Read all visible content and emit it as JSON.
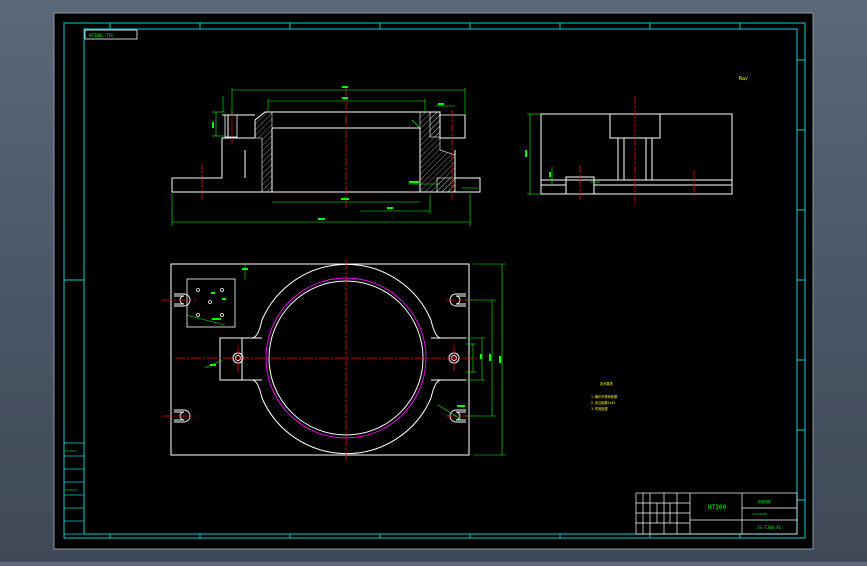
{
  "drawing": {
    "sheet_title_tag": "HT300L-TTX",
    "roughness_mark": "Ra√",
    "material": "HT300",
    "notes": [
      "技术要求",
      "1.铸件不得有砂眼",
      "2.未注倒角1x45",
      "3.时效处理"
    ]
  },
  "title_block": {
    "material": "HT300",
    "top_right": "机架底座",
    "mid_right": "××××××××",
    "drawing_no": "JS-TJ08-A1"
  },
  "revision_table": {
    "rows": [
      "××××××",
      "",
      "",
      "××××××",
      "",
      "",
      ""
    ]
  },
  "colors": {
    "background": "#000000",
    "frame": "#00d0d0",
    "outline": "#ffffff",
    "center": "#ff0000",
    "dimension": "#00ff00",
    "bore_inner": "#ff00ff",
    "dim_text": "#ffff00"
  }
}
